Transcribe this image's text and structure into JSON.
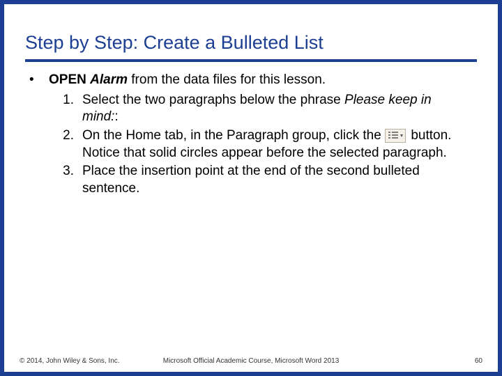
{
  "title": "Step by Step: Create a Bulleted List",
  "bullet": {
    "dot": "•",
    "open": "OPEN",
    "alarm": "Alarm",
    "rest": " from the data files for this lesson."
  },
  "steps": [
    {
      "num": "1.",
      "pre": "Select the two paragraphs below the phrase ",
      "phrase": "Please keep in mind:",
      "post": ":"
    },
    {
      "num": "2.",
      "pre": "On the Home tab, in the Paragraph group, click the ",
      "post": " button. Notice that solid circles appear before the selected paragraph."
    },
    {
      "num": "3.",
      "pre": "Place the insertion point at the end of the second bulleted sentence."
    }
  ],
  "footer": {
    "left": "© 2014, John Wiley & Sons, Inc.",
    "center": "Microsoft Official Academic Course, Microsoft Word 2013",
    "right": "60"
  }
}
